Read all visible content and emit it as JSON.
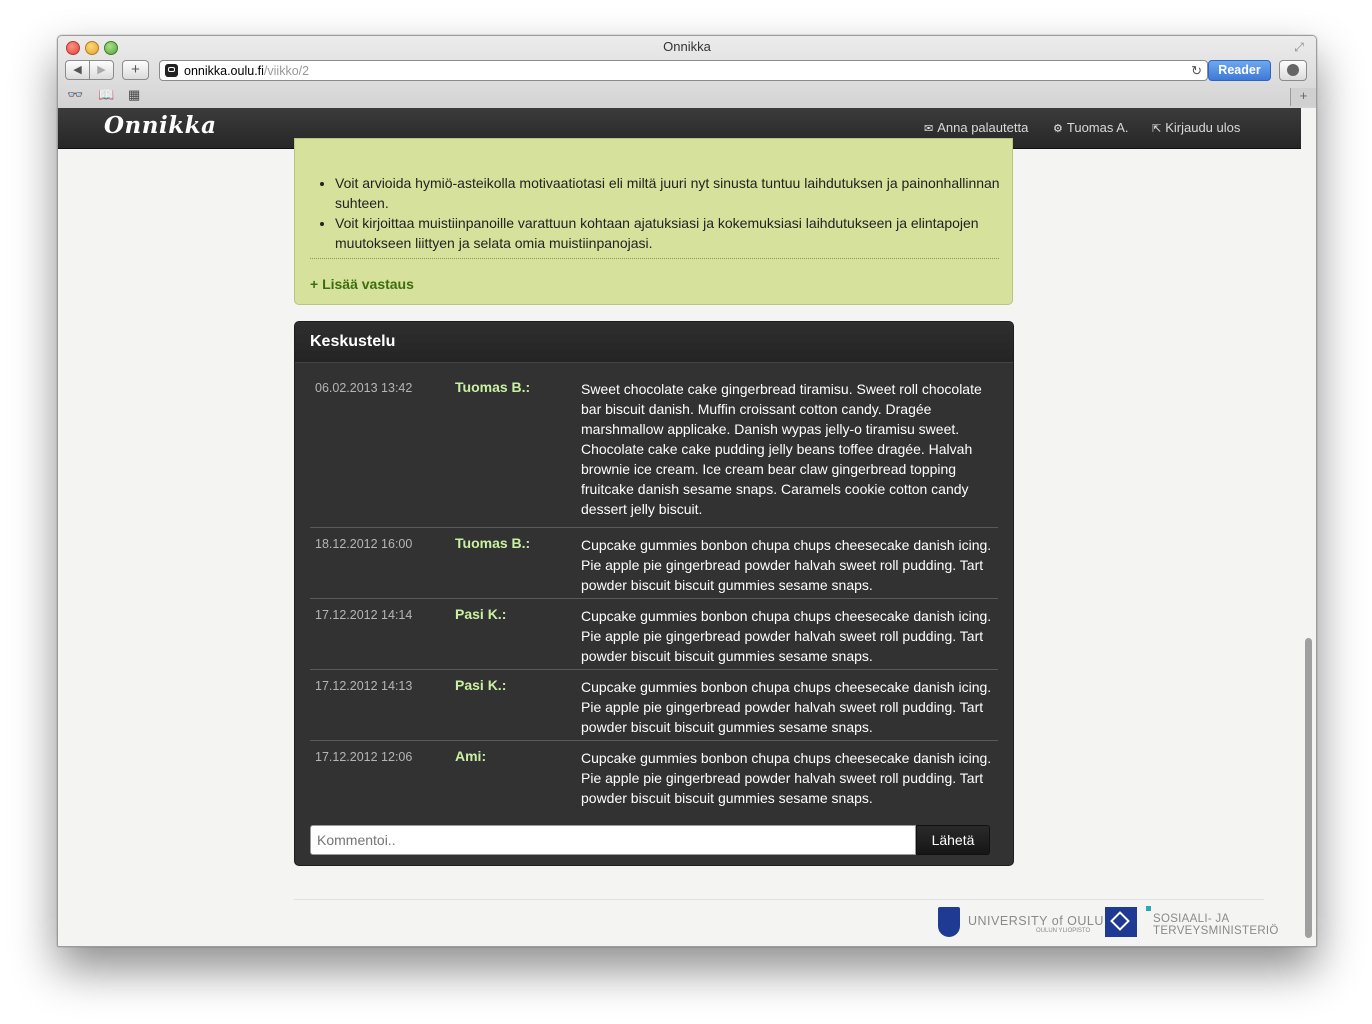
{
  "browser": {
    "window_title": "Onnikka",
    "url_host": "onnikka.oulu.fi",
    "url_path": "/viikko/2",
    "reader_label": "Reader",
    "add_label": "+",
    "back_glyph": "◀",
    "forward_glyph": "▶",
    "reload_glyph": "↻",
    "tab_plus_glyph": "+",
    "icons": [
      "back-icon",
      "forward-icon",
      "reading-list-icon",
      "bookmarks-icon",
      "top-sites-icon",
      "reload-icon",
      "download-icon",
      "fullscreen-icon"
    ]
  },
  "navbar": {
    "brand": "Onnikka",
    "feedback": "Anna palautetta",
    "user": "Tuomas A.",
    "logout": "Kirjaudu ulos",
    "feedback_icon": "✉",
    "user_icon": "⚙",
    "logout_icon": "⇱"
  },
  "info_box": {
    "bullets": [
      "Voit arvioida hymiö-asteikolla motivaatiotasi eli miltä juuri nyt sinusta tuntuu laihdutuksen ja painonhallinnan suhteen.",
      "Voit kirjoittaa muistiinpanoille varattuun kohtaan ajatuksiasi ja kokemuksiasi laihdutukseen ja elintapojen muutokseen liittyen ja selata omia muistiinpanojasi."
    ],
    "add_answer": "+ Lisää vastaus"
  },
  "discussion": {
    "title": "Keskustelu",
    "messages": [
      {
        "time": "06.02.2013 13:42",
        "user": "Tuomas B.:",
        "text": "Sweet chocolate cake gingerbread tiramisu. Sweet roll chocolate bar biscuit danish. Muffin croissant cotton candy. Dragée marshmallow applicake. Danish wypas jelly-o tiramisu sweet. Chocolate cake cake pudding jelly beans toffee dragée. Halvah brownie ice cream. Ice cream bear claw gingerbread topping fruitcake danish sesame snaps. Caramels cookie cotton candy dessert jelly biscuit."
      },
      {
        "time": "18.12.2012 16:00",
        "user": "Tuomas B.:",
        "text": "Cupcake gummies bonbon chupa chups cheesecake danish icing. Pie apple pie gingerbread powder halvah sweet roll pudding. Tart powder biscuit biscuit gummies sesame snaps."
      },
      {
        "time": "17.12.2012 14:14",
        "user": "Pasi K.:",
        "text": "Cupcake gummies bonbon chupa chups cheesecake danish icing. Pie apple pie gingerbread powder halvah sweet roll pudding. Tart powder biscuit biscuit gummies sesame snaps."
      },
      {
        "time": "17.12.2012 14:13",
        "user": "Pasi K.:",
        "text": "Cupcake gummies bonbon chupa chups cheesecake danish icing. Pie apple pie gingerbread powder halvah sweet roll pudding. Tart powder biscuit biscuit gummies sesame snaps."
      },
      {
        "time": "17.12.2012 12:06",
        "user": "Ami:",
        "text": "Cupcake gummies bonbon chupa chups cheesecake danish icing. Pie apple pie gingerbread powder halvah sweet roll pudding. Tart powder biscuit biscuit gummies sesame snaps."
      }
    ],
    "comment_placeholder": "Kommentoi..",
    "send_label": "Lähetä"
  },
  "footer": {
    "university_name": "UNIVERSITY of OULU",
    "university_sub": "OULUN YLIOPISTO",
    "ministry_line1": "SOSIAALI- JA",
    "ministry_line2": "TERVEYSMINISTERIÖ"
  },
  "colors": {
    "navbar": "#2e2e2e",
    "info_box": "#d6e29c",
    "discussion_bg": "#323232",
    "username": "#c9f0a3",
    "add_answer": "#3c6d0f",
    "reader_button": "#4a86e0"
  }
}
